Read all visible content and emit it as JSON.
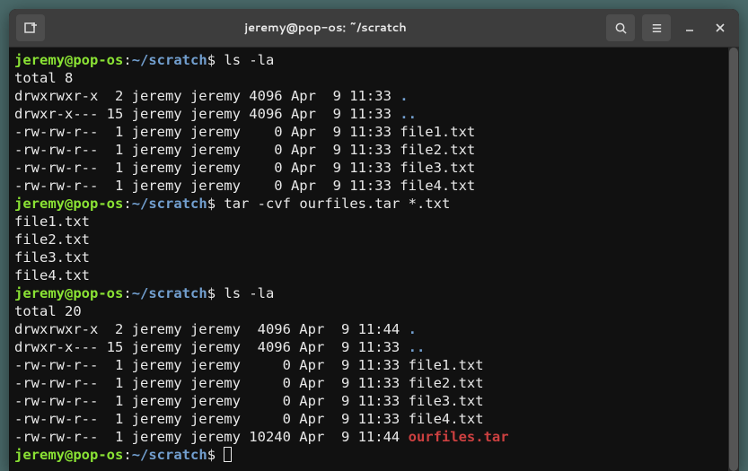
{
  "titlebar": {
    "title": "jeremy@pop-os: ~/scratch"
  },
  "prompt": {
    "user": "jeremy",
    "at": "@",
    "host": "pop-os",
    "colon": ":",
    "path": "~/scratch",
    "dollar": "$ "
  },
  "cmd": {
    "ls1": "ls -la",
    "tar": "tar -cvf ourfiles.tar *.txt",
    "ls2": "ls -la"
  },
  "out": {
    "total1": "total 8",
    "ls1_l1": "drwxrwxr-x  2 jeremy jeremy 4096 Apr  9 11:33 ",
    "ls1_l1_name": ".",
    "ls1_l2": "drwxr-x--- 15 jeremy jeremy 4096 Apr  9 11:33 ",
    "ls1_l2_name": "..",
    "ls1_l3": "-rw-rw-r--  1 jeremy jeremy    0 Apr  9 11:33 file1.txt",
    "ls1_l4": "-rw-rw-r--  1 jeremy jeremy    0 Apr  9 11:33 file2.txt",
    "ls1_l5": "-rw-rw-r--  1 jeremy jeremy    0 Apr  9 11:33 file3.txt",
    "ls1_l6": "-rw-rw-r--  1 jeremy jeremy    0 Apr  9 11:33 file4.txt",
    "tar_l1": "file1.txt",
    "tar_l2": "file2.txt",
    "tar_l3": "file3.txt",
    "tar_l4": "file4.txt",
    "total2": "total 20",
    "ls2_l1": "drwxrwxr-x  2 jeremy jeremy  4096 Apr  9 11:44 ",
    "ls2_l1_name": ".",
    "ls2_l2": "drwxr-x--- 15 jeremy jeremy  4096 Apr  9 11:33 ",
    "ls2_l2_name": "..",
    "ls2_l3": "-rw-rw-r--  1 jeremy jeremy     0 Apr  9 11:33 file1.txt",
    "ls2_l4": "-rw-rw-r--  1 jeremy jeremy     0 Apr  9 11:33 file2.txt",
    "ls2_l5": "-rw-rw-r--  1 jeremy jeremy     0 Apr  9 11:33 file3.txt",
    "ls2_l6": "-rw-rw-r--  1 jeremy jeremy     0 Apr  9 11:33 file4.txt",
    "ls2_l7": "-rw-rw-r--  1 jeremy jeremy 10240 Apr  9 11:44 ",
    "ls2_l7_name": "ourfiles.tar"
  }
}
